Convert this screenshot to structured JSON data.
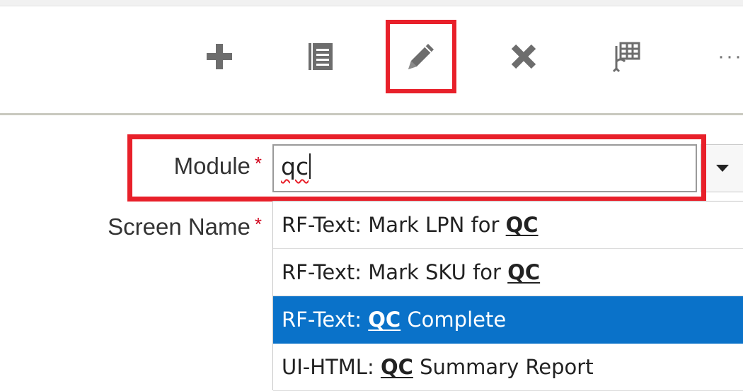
{
  "toolbar": {
    "buttons": [
      {
        "name": "add",
        "icon": "plus-icon"
      },
      {
        "name": "copy",
        "icon": "document-icon"
      },
      {
        "name": "edit",
        "icon": "pencil-icon",
        "highlighted": true
      },
      {
        "name": "delete",
        "icon": "close-icon"
      },
      {
        "name": "export",
        "icon": "table-export-icon"
      }
    ],
    "more_label": "···"
  },
  "form": {
    "module": {
      "label": "Module",
      "required_mark": "*",
      "value": "qc",
      "highlighted": true
    },
    "screen_name": {
      "label": "Screen Name",
      "required_mark": "*"
    }
  },
  "autocomplete": {
    "options": [
      {
        "prefix": "RF-Text: Mark LPN for ",
        "match": "QC",
        "suffix": "",
        "selected": false
      },
      {
        "prefix": "RF-Text: Mark SKU for ",
        "match": "QC",
        "suffix": "",
        "selected": false
      },
      {
        "prefix": "RF-Text: ",
        "match": "QC",
        "suffix": " Complete",
        "selected": true
      },
      {
        "prefix": "UI-HTML: ",
        "match": "QC",
        "suffix": " Summary Report",
        "selected": false
      }
    ]
  },
  "colors": {
    "highlight": "#e8202a",
    "selected_option": "#0a72c9",
    "icon": "#6d6d6d",
    "required": "#d0021b"
  }
}
